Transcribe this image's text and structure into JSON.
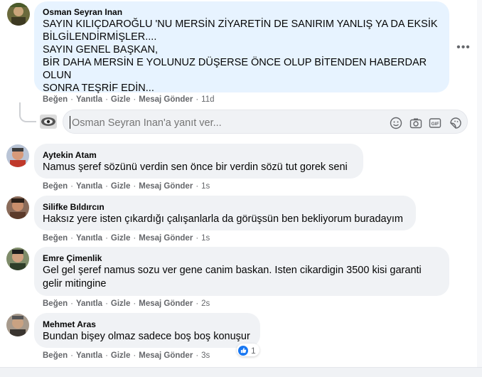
{
  "comments": [
    {
      "author": "Osman Seyran Inan",
      "text": "SAYIN KILIÇDAROĞLU 'NU MERSİN ZİYARETİN DE SANIRIM YANLIŞ YA DA EKSİK\nBİLGİLENDİRMİŞLER....\nSAYIN GENEL BAŞKAN,\nBİR DAHA MERSİN E YOLUNUZ DÜŞERSE ÖNCE OLUP BİTENDEN HABERDAR OLUN\nSONRA TEŞRİF EDİN...",
      "actions": {
        "like": "Beğen",
        "reply": "Yanıtla",
        "hide": "Gizle",
        "message": "Mesaj Gönder",
        "time": "11d"
      }
    },
    {
      "author": "Aytekin Atam",
      "text": "Namus şeref sözünü verdin sen önce bir verdin sözü tut gorek seni",
      "actions": {
        "like": "Beğen",
        "reply": "Yanıtla",
        "hide": "Gizle",
        "message": "Mesaj Gönder",
        "time": "1s"
      }
    },
    {
      "author": "Silifke Bıldırcın",
      "text": "Haksız yere isten çıkardığı çalışanlarla da görüşsün ben bekliyorum buradayım",
      "actions": {
        "like": "Beğen",
        "reply": "Yanıtla",
        "hide": "Gizle",
        "message": "Mesaj Gönder",
        "time": "1s"
      }
    },
    {
      "author": "Emre Çimenlik",
      "text": "Gel gel şeref namus sozu ver gene canim baskan. Isten cikardigin 3500 kisi garanti\ngelir mitingine",
      "actions": {
        "like": "Beğen",
        "reply": "Yanıtla",
        "hide": "Gizle",
        "message": "Mesaj Gönder",
        "time": "2s"
      }
    },
    {
      "author": "Mehmet Aras",
      "text": "Bundan bişey olmaz sadece boş boş konuşur",
      "actions": {
        "like": "Beğen",
        "reply": "Yanıtla",
        "hide": "Gizle",
        "message": "Mesaj Gönder",
        "time": "3s"
      },
      "reaction_count": "1"
    }
  ],
  "reply_box": {
    "placeholder": "Osman Seyran Inan'a yanıt ver..."
  },
  "icons": {
    "more": "more-options-icon",
    "emoji": "emoji-icon",
    "camera": "camera-icon",
    "gif": "gif-icon",
    "sticker": "sticker-icon",
    "like_reaction": "like-reaction-icon"
  },
  "colors": {
    "bubble": "#f0f2f5",
    "highlight_bubble": "#e7f3ff",
    "secondary_text": "#65676b",
    "like_blue": "#1877f2"
  }
}
